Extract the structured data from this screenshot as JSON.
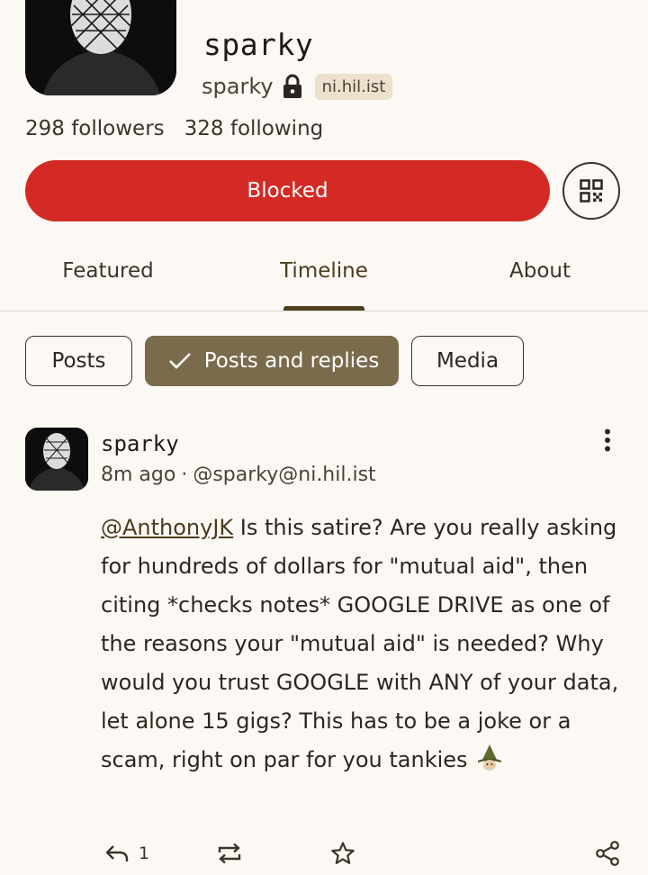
{
  "profile": {
    "display_name": "sparky",
    "handle": "sparky",
    "instance": "ni.hil.ist",
    "followers": "298 followers",
    "following": "328 following",
    "locked_icon": "lock-icon",
    "block_label": "Blocked",
    "qr_icon": "qr-code-icon"
  },
  "tabs": [
    {
      "label": "Featured"
    },
    {
      "label": "Timeline",
      "selected": true
    },
    {
      "label": "About"
    }
  ],
  "filters": [
    {
      "label": "Posts"
    },
    {
      "label": "Posts and replies",
      "selected": true
    },
    {
      "label": "Media"
    }
  ],
  "post": {
    "author": "sparky",
    "time": "8m ago",
    "separator": "·",
    "acct": "@sparky@ni.hil.ist",
    "mention": "@AnthonyJK",
    "text": " Is this satire? Are you really asking for hundreds of dollars for \"mutual aid\", then citing *checks notes* GOOGLE DRIVE as one of the reasons your \"mutual aid\" is needed? Why would you trust GOOGLE with ANY of your data, let alone 15 gigs? This has to be a joke or a scam, right on par for you tankies ",
    "emoji": "gnome-emoji-icon",
    "reply_count": "1"
  },
  "colors": {
    "background": "#fcf8f3",
    "block_red": "#d42a25",
    "chip_selected": "#7a6b4c",
    "tab_accent": "#4e4020",
    "badge_bg": "#ece1cd"
  }
}
